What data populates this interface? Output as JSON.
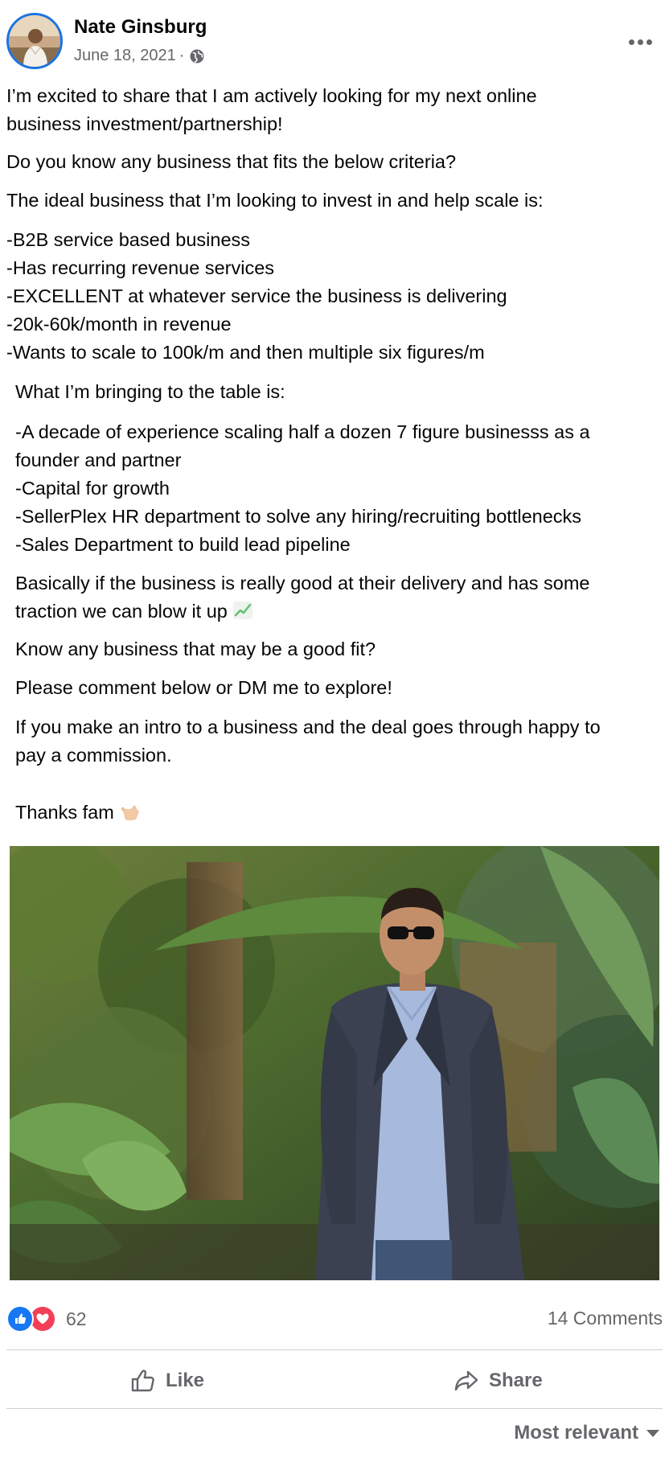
{
  "author": {
    "name": "Nate Ginsburg",
    "date": "June 18, 2021",
    "separator": "·"
  },
  "post_lines": [
    "I’m excited to share that I am actively looking for my next online",
    "business investment/partnership!",
    "Do you know any business that fits the below criteria?",
    "The ideal business that I’m looking to invest in and help scale is:",
    "-B2B service based business",
    "-Has recurring revenue services",
    "-EXCELLENT at whatever service the business is delivering",
    "-20k-60k/month in revenue",
    "-Wants to scale to 100k/m and then multiple six figures/m",
    "What I’m bringing to the table is:",
    "-A decade of experience scaling half a dozen 7 figure businesss as a",
    "founder and partner",
    "-Capital for growth",
    "-SellerPlex HR department to solve any hiring/recruiting bottlenecks",
    "-Sales Department to build lead pipeline",
    "Basically if the business is really good at their delivery and has some",
    "traction we can blow it up",
    "Know any business that may be a good fit?",
    "Please comment below or DM me to explore!",
    "If you make an intro to a business and the deal goes through happy to",
    "pay a commission.",
    "Thanks fam"
  ],
  "reactions": {
    "count": "62",
    "comments": "14 Comments"
  },
  "actions": {
    "like": "Like",
    "share": "Share"
  },
  "sort_label": "Most relevant",
  "icons": {
    "avatar": "profile-photo",
    "privacy": "globe-icon",
    "more": "more-options-icon",
    "reaction_like": "thumbs-up-icon",
    "reaction_love": "heart-icon",
    "like_action": "thumbs-up-outline-icon",
    "share_action": "share-arrow-icon",
    "sort": "caret-down-icon",
    "chart_emoji": "chart-increasing-emoji",
    "hand_emoji": "call-me-hand-emoji"
  },
  "colors": {
    "accent_blue": "#1877f2",
    "love_red": "#f33e58",
    "secondary_text": "#65676b",
    "divider": "#ced0d4"
  }
}
